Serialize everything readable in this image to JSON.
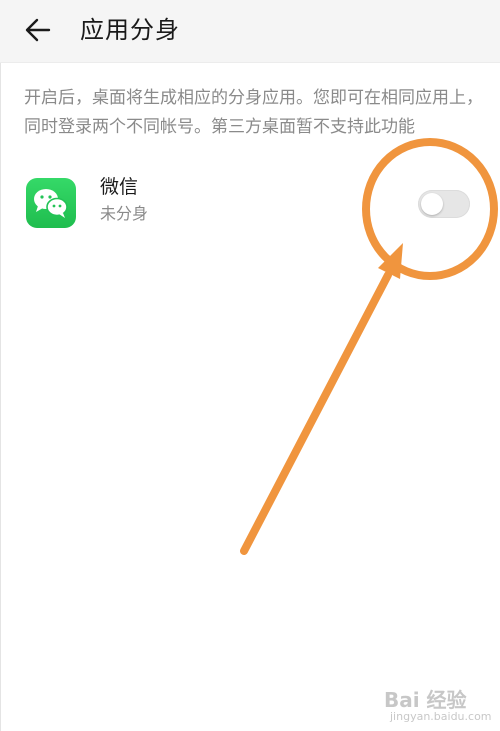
{
  "header": {
    "back_icon": "arrow-left-icon",
    "title": "应用分身"
  },
  "description": "开启后，桌面将生成相应的分身应用。您即可在相同应用上，同时登录两个不同帐号。第三方桌面暂不支持此功能",
  "apps": [
    {
      "name": "微信",
      "status": "未分身",
      "icon": "wechat-icon",
      "toggle_on": false
    }
  ],
  "colors": {
    "header_bg": "#f5f5f5",
    "wechat_green": "#22c356",
    "annotation_orange": "#f0953e",
    "secondary_text": "#8a8a8a"
  },
  "watermark": {
    "brand": "Bai 经验",
    "site": "jingyan.baidu.com"
  }
}
